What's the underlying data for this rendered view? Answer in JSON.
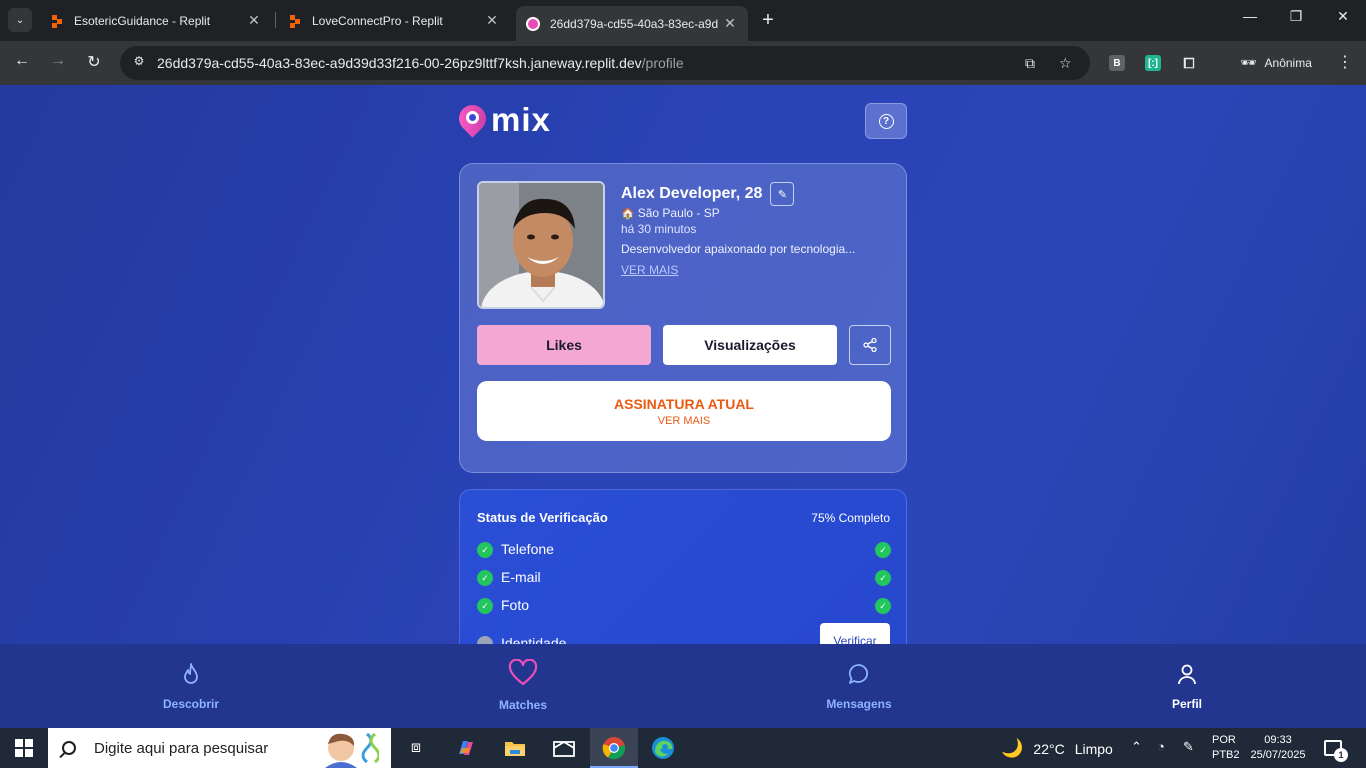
{
  "browser": {
    "tabs": [
      {
        "title": "EsotericGuidance - Replit",
        "favicon": "replit-icon"
      },
      {
        "title": "LoveConnectPro - Replit",
        "favicon": "replit-icon"
      },
      {
        "title": "26dd379a-cd55-40a3-83ec-a9d",
        "favicon": "mix-pin-icon",
        "active": true
      }
    ],
    "url_host": "26dd379a-cd55-40a3-83ec-a9d39d33f216-00-26pz9lttf7ksh.janeway.replit.dev",
    "url_path": "/profile",
    "profile_label": "Anônima",
    "extensions": [
      "B",
      "[:]"
    ]
  },
  "app": {
    "logo_text": "mix",
    "brand_colors": {
      "pink": "#f4a7d3",
      "orange": "#ea5a12",
      "blue": "#2b46b8"
    },
    "profile": {
      "name": "Alex Developer, 28",
      "location": "São Paulo - SP",
      "last_seen": "há 30 minutos",
      "bio": "Desenvolvedor apaixonado por tecnologia...",
      "more_link": "VER MAIS"
    },
    "buttons": {
      "likes": "Likes",
      "views": "Visualizações"
    },
    "subscription": {
      "title": "ASSINATURA ATUAL",
      "more": "VER MAIS"
    },
    "verification": {
      "title": "Status de Verificação",
      "progress_text": "75% Completo",
      "items": [
        {
          "label": "Telefone",
          "verified": true
        },
        {
          "label": "E-mail",
          "verified": true
        },
        {
          "label": "Foto",
          "verified": true
        },
        {
          "label": "Identidade",
          "verified": false
        }
      ],
      "verify_button": "Verificar"
    },
    "bottom_nav": [
      {
        "label": "Descobrir",
        "icon": "flame-icon"
      },
      {
        "label": "Matches",
        "icon": "heart-icon"
      },
      {
        "label": "Mensagens",
        "icon": "chat-bubble-icon"
      },
      {
        "label": "Perfil",
        "icon": "user-icon",
        "active": true
      }
    ]
  },
  "taskbar": {
    "search_placeholder": "Digite aqui para pesquisar",
    "weather_temp": "22°C",
    "weather_desc": "Limpo",
    "lang_line1": "POR",
    "lang_line2": "PTB2",
    "time": "09:33",
    "date": "25/07/2025",
    "notification_count": "1"
  }
}
